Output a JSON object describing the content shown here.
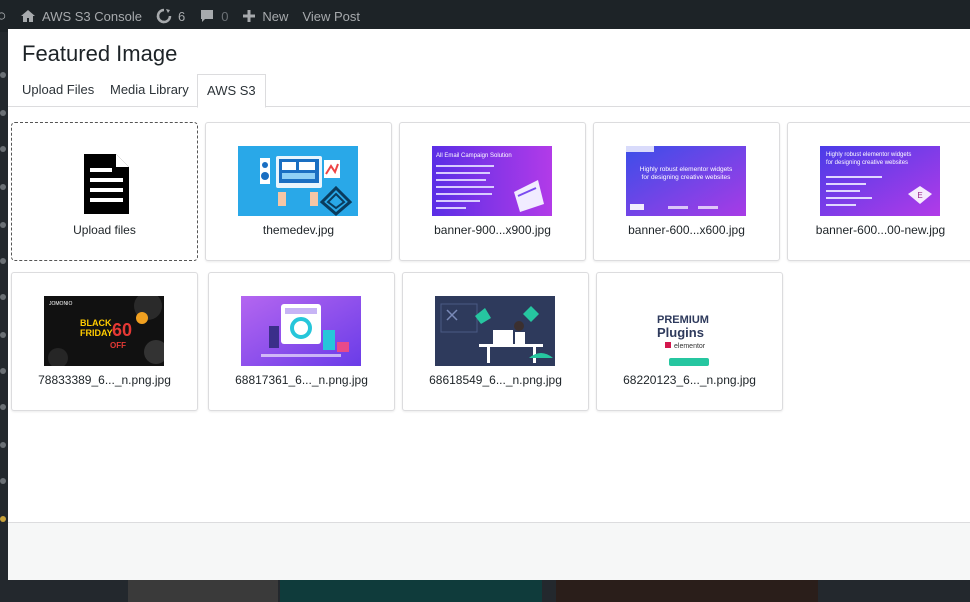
{
  "adminbar": {
    "site_name": "AWS S3 Console",
    "updates_count": "6",
    "comments_count": "0",
    "new_label": "New",
    "view_post_label": "View Post"
  },
  "modal": {
    "title": "Featured Image",
    "tabs": [
      {
        "label": "Upload Files"
      },
      {
        "label": "Media Library"
      },
      {
        "label": "AWS S3"
      }
    ],
    "active_tab": "AWS S3",
    "upload_card_label": "Upload files",
    "files": [
      {
        "name": "themedev.jpg",
        "thumb": "themedev"
      },
      {
        "name": "banner-900...x900.jpg",
        "thumb": "email-campaign"
      },
      {
        "name": "banner-600...x600.jpg",
        "thumb": "elementor-widgets"
      },
      {
        "name": "banner-600...00-new.jpg",
        "thumb": "elementor-widgets-new"
      },
      {
        "name": "78833389_6..._n.png.jpg",
        "thumb": "black-friday"
      },
      {
        "name": "68817361_6..._n.png.jpg",
        "thumb": "purple-illustration"
      },
      {
        "name": "68618549_6..._n.png.jpg",
        "thumb": "navy-illustration"
      },
      {
        "name": "68220123_6..._n.png.jpg",
        "thumb": "premium-plugins"
      }
    ],
    "thumb_text": {
      "email_title": "All Email Campaign Solution",
      "elementor_line1": "Highly robust elementor widgets",
      "elementor_line2": "for designing creative websites",
      "black_friday_brand": "JOMONIO",
      "black_friday_word1": "BLACK",
      "black_friday_word2": "FRIDAY",
      "black_friday_number": "60",
      "black_friday_off": "OFF",
      "premium_word": "PREMIUM",
      "plugins_word": "Plugins",
      "elementor_brand": "elementor"
    }
  },
  "colors": {
    "adminbar_bg": "#1d2327",
    "modal_bg": "#ffffff",
    "border": "#dcdcde",
    "text": "#1d2327"
  }
}
